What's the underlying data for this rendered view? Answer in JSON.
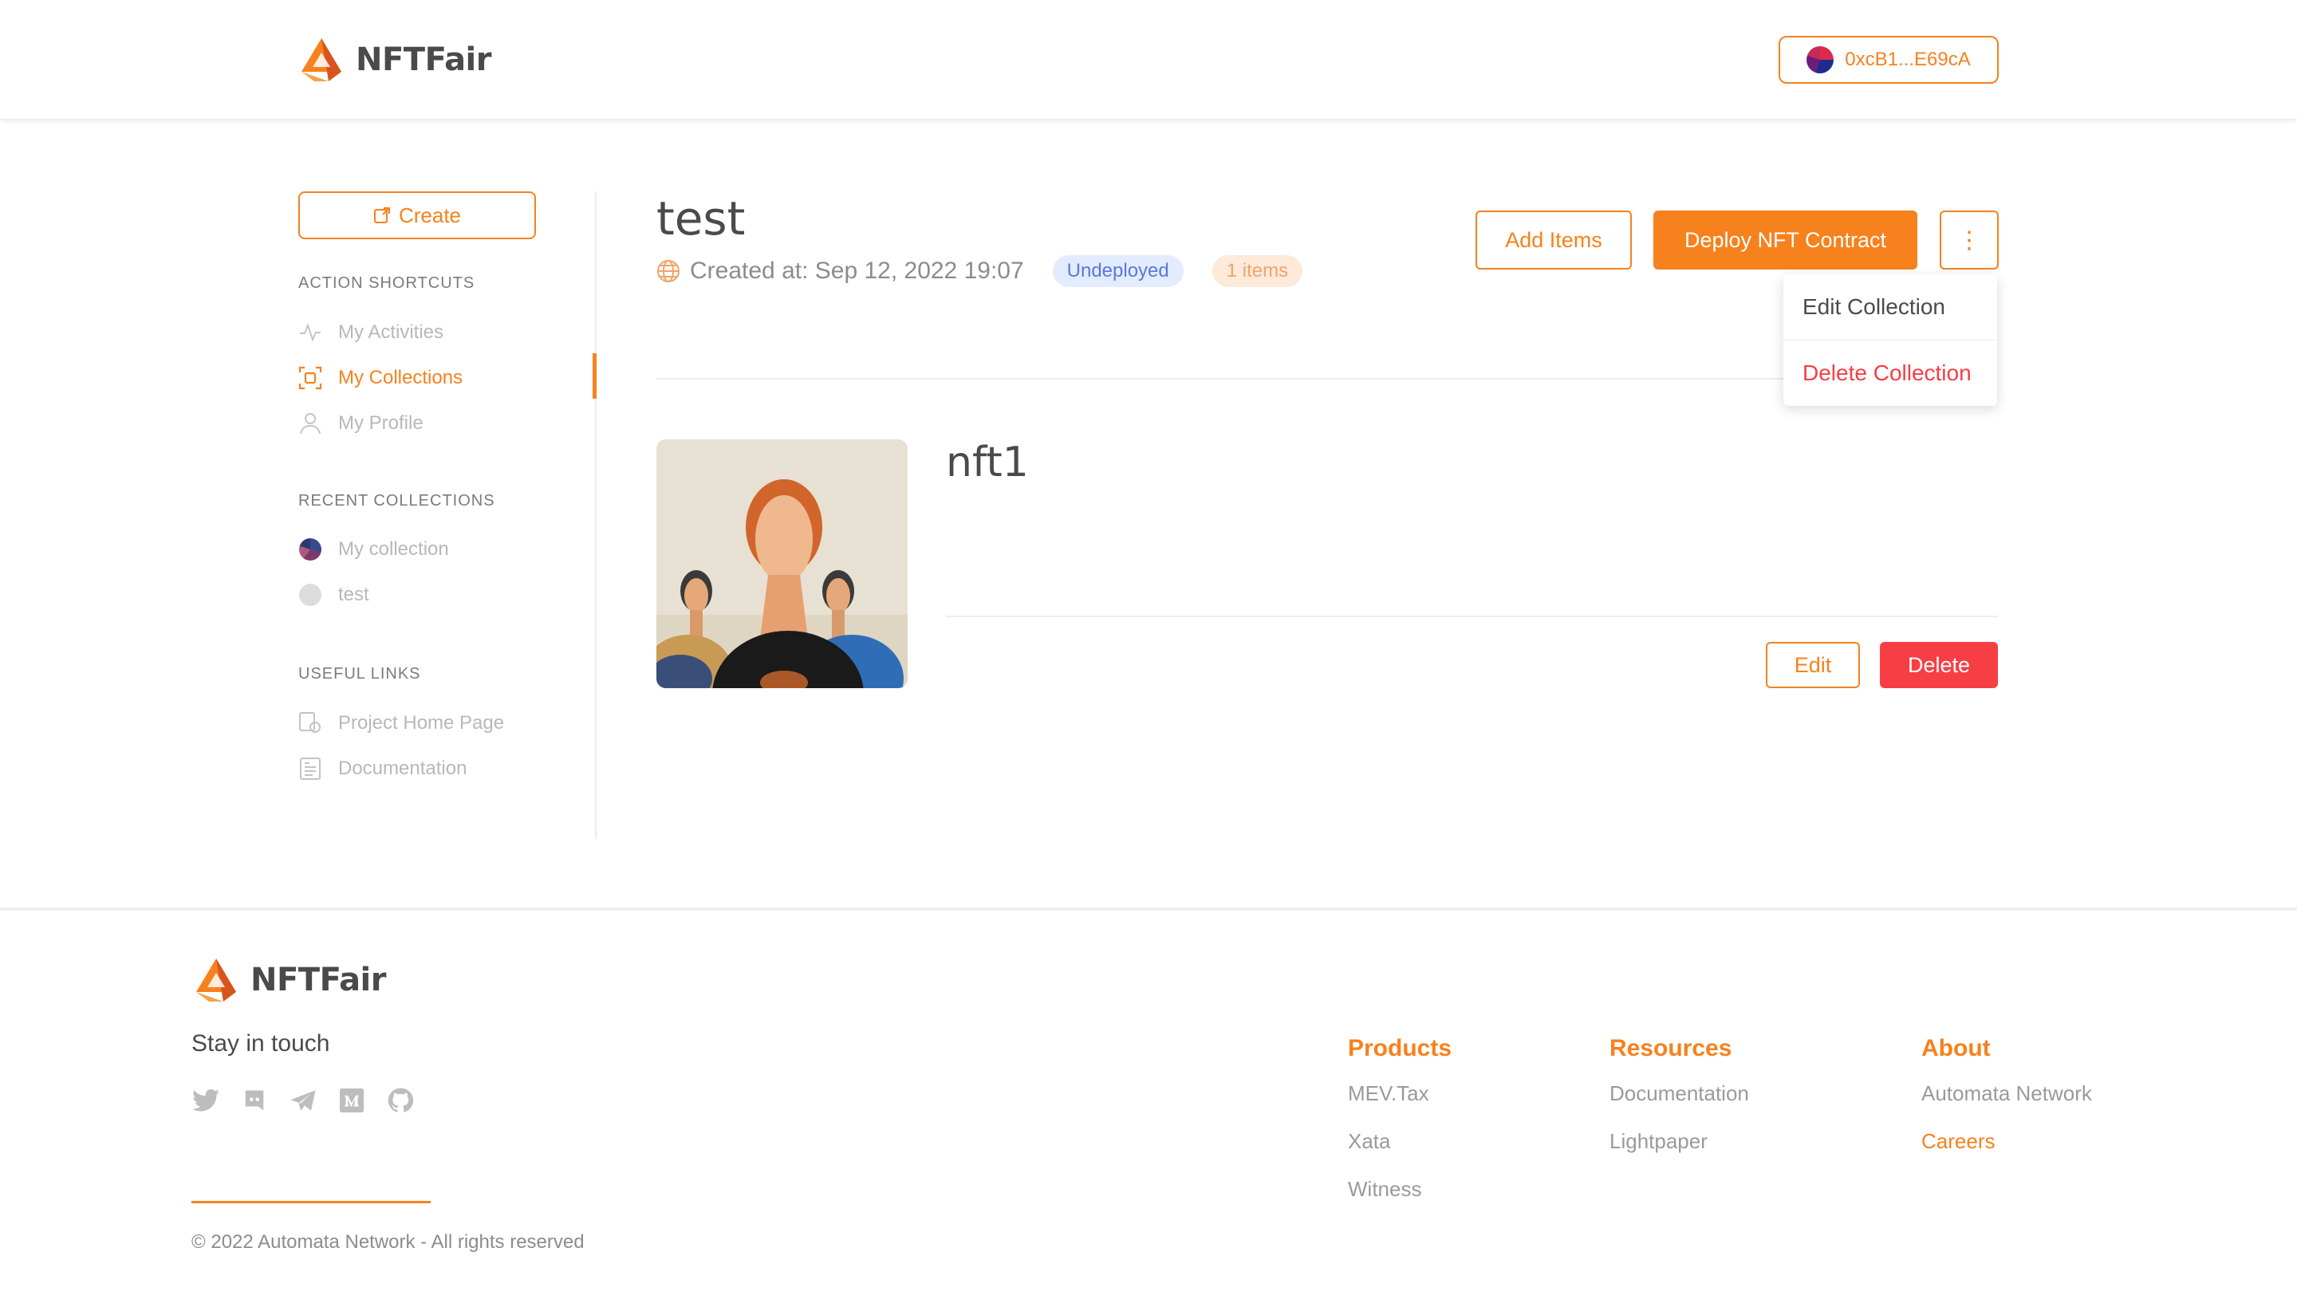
{
  "brand": {
    "name": "NFTFair",
    "accent": "#f7811d",
    "danger": "#f63e44"
  },
  "header": {
    "wallet_address": "0xcB1...E69cA"
  },
  "sidebar": {
    "create_label": "Create",
    "action_shortcuts_title": "ACTION SHORTCUTS",
    "actions": [
      {
        "label": "My Activities",
        "icon": "activity-icon"
      },
      {
        "label": "My Collections",
        "icon": "collections-icon",
        "active": true
      },
      {
        "label": "My Profile",
        "icon": "user-icon"
      }
    ],
    "recent_collections_title": "RECENT COLLECTIONS",
    "recent": [
      {
        "label": "My collection"
      },
      {
        "label": "test"
      }
    ],
    "useful_links_title": "USEFUL LINKS",
    "links": [
      {
        "label": "Project Home Page",
        "icon": "home-page-icon"
      },
      {
        "label": "Documentation",
        "icon": "documentation-icon"
      }
    ]
  },
  "collection": {
    "title": "test",
    "created_at": "Created at: Sep 12, 2022 19:07",
    "status_badge": "Undeployed",
    "items_badge": "1 items",
    "add_items_label": "Add Items",
    "deploy_label": "Deploy NFT Contract",
    "more_label": "⋮",
    "menu": {
      "edit_label": "Edit Collection",
      "delete_label": "Delete Collection"
    }
  },
  "nft": {
    "name": "nft1",
    "edit_label": "Edit",
    "delete_label": "Delete"
  },
  "footer": {
    "stay_in_touch": "Stay in touch",
    "socials": [
      "twitter-icon",
      "discord-icon",
      "telegram-icon",
      "medium-icon",
      "github-icon"
    ],
    "columns": [
      {
        "title": "Products",
        "links": [
          "MEV.Tax",
          "Xata",
          "Witness"
        ]
      },
      {
        "title": "Resources",
        "links": [
          "Documentation",
          "Lightpaper"
        ]
      },
      {
        "title": "About",
        "links": [
          "Automata Network",
          "Careers"
        ]
      }
    ],
    "copyright": "© 2022 Automata Network - All rights reserved"
  }
}
